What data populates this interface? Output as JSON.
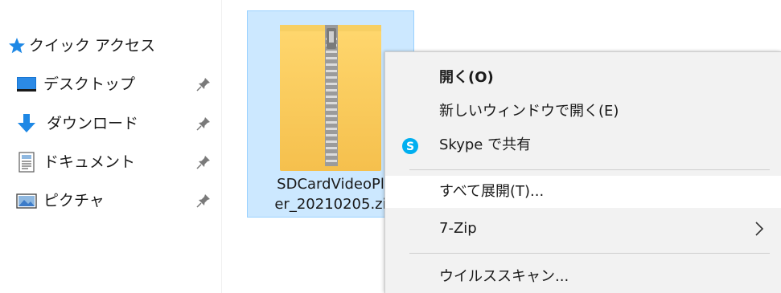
{
  "navigation": {
    "quick_access": {
      "label": "クイック アクセス",
      "icon": "star-icon"
    },
    "items": [
      {
        "label": "デスクトップ",
        "icon": "desktop-icon",
        "pinned": true
      },
      {
        "label": "ダウンロード",
        "icon": "download-arrow-icon",
        "pinned": true
      },
      {
        "label": "ドキュメント",
        "icon": "document-icon",
        "pinned": true
      },
      {
        "label": "ピクチャ",
        "icon": "pictures-icon",
        "pinned": true
      }
    ]
  },
  "file": {
    "name": "SDCardVideoPl\ner_20210205.zi",
    "icon": "zip-folder-icon",
    "selected": true
  },
  "context_menu": {
    "items": [
      {
        "label": "開く(O)",
        "bold": true
      },
      {
        "label": "新しいウィンドウで開く(E)"
      },
      {
        "label": "Skype で共有",
        "icon": "skype-icon"
      },
      {
        "label": "すべて展開(T)...",
        "highlighted": true
      },
      {
        "label": "7-Zip",
        "submenu": true
      },
      {
        "label": "ウイルススキャン..."
      }
    ]
  },
  "colors": {
    "selection_fill": "#cce8ff",
    "selection_border": "#99d1ff",
    "menu_background": "#f2f2f2",
    "menu_highlight": "#ffffff",
    "accent_blue": "#1e88e5",
    "skype_blue": "#00aff0"
  }
}
